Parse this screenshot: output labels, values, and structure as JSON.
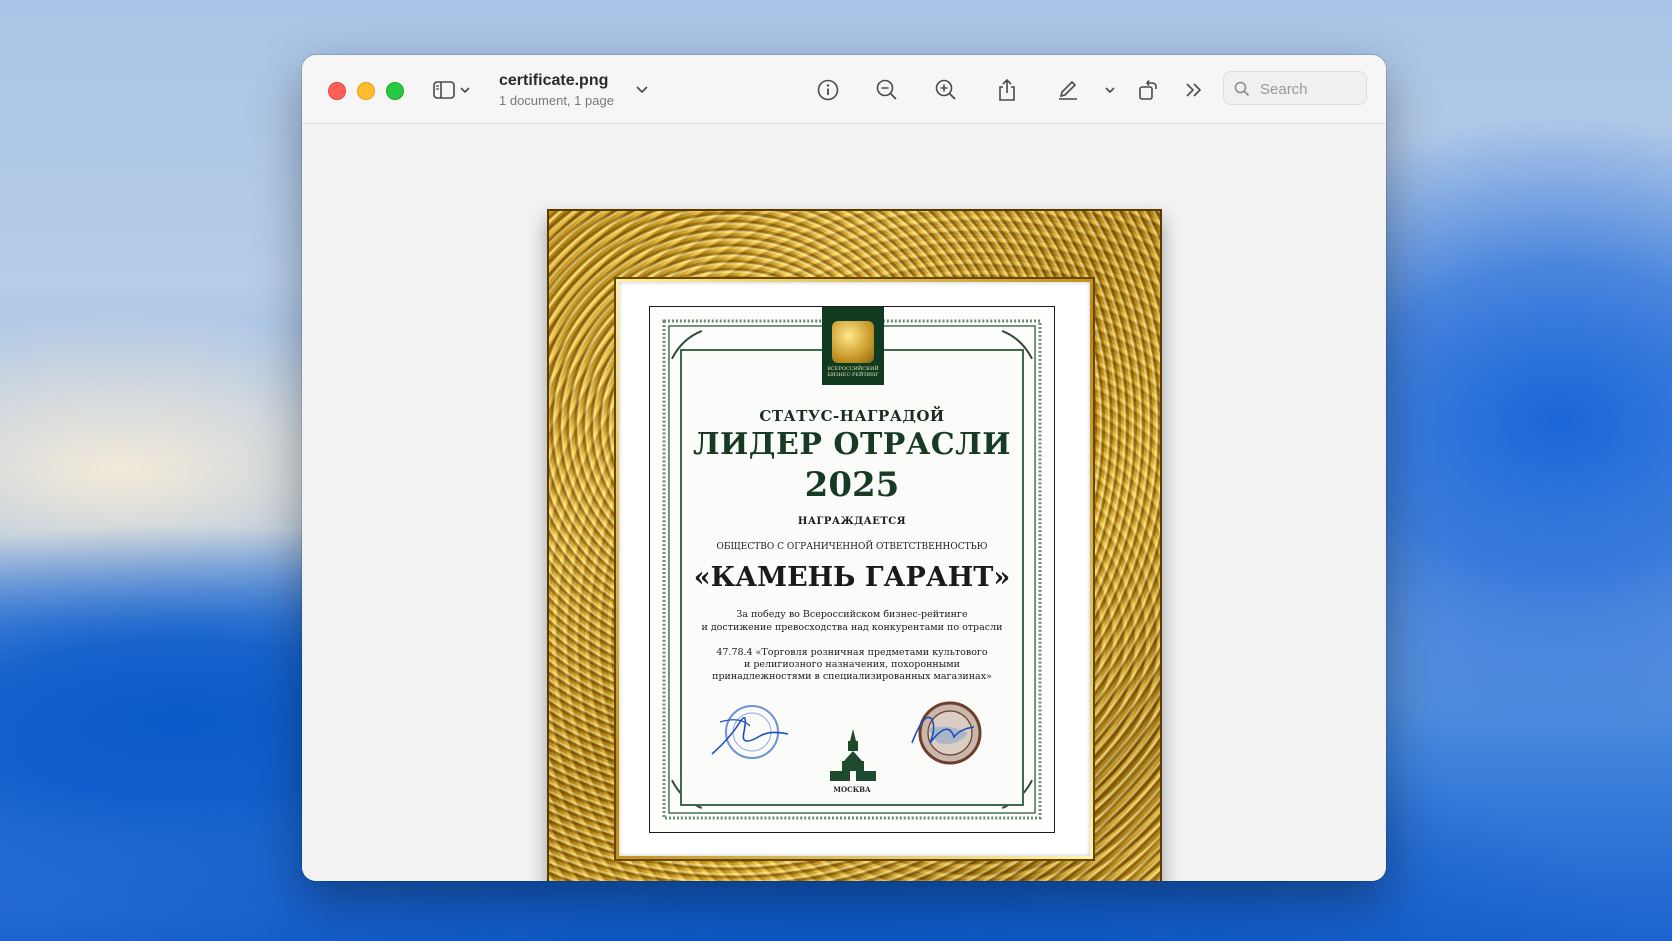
{
  "window": {
    "file_name": "certificate.png",
    "file_info": "1 document, 1 page",
    "search_placeholder": "Search"
  },
  "toolbar": {
    "icons": [
      "sidebar-icon",
      "chevron-down-icon",
      "info-icon",
      "zoom-out-icon",
      "zoom-in-icon",
      "share-icon",
      "markup-pen-icon",
      "chevron-down-icon",
      "rotate-icon",
      "more-icon",
      "search-icon"
    ]
  },
  "certificate": {
    "badge_text": "ВСЕРОССИЙСКИЙ БИЗНЕС-РЕЙТИНГ",
    "status_line": "СТАТУС-НАГРАДОЙ",
    "title": "ЛИДЕР ОТРАСЛИ",
    "year": "2025",
    "awarded": "НАГРАЖДАЕТСЯ",
    "org_type": "ОБЩЕСТВО С ОГРАНИЧЕННОЙ ОТВЕТСТВЕННОСТЬЮ",
    "company": "«КАМЕНЬ ГАРАНТ»",
    "reason_line1": "За победу во Всероссийском бизнес-рейтинге",
    "reason_line2": "и достижение превосходства над конкурентами по отрасли",
    "code_line1": "47.78.4 «Торговля розничная предметами культового",
    "code_line2": "и религиозного назначения, похоронными",
    "code_line3": "принадлежностями в специализированных магазинах»",
    "city": "МОСКВА"
  },
  "colors": {
    "accent_green": "#163a22",
    "frame_gold": "#d4a52a",
    "close": "#ff5f57",
    "minimize": "#febc2e",
    "maximize": "#28c840"
  }
}
